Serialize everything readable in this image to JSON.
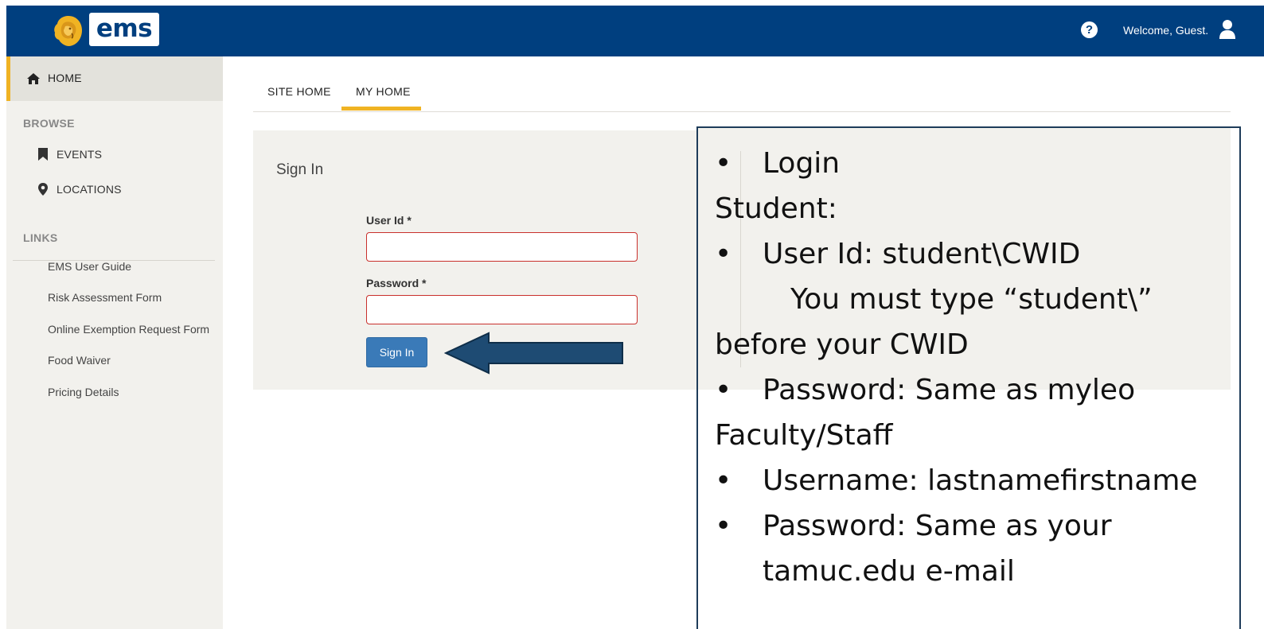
{
  "header": {
    "logo_text": "ems",
    "welcome_text": "Welcome, Guest.",
    "help_icon": "question-circle-icon",
    "user_icon": "user-icon",
    "bar_color": "#003f7f"
  },
  "sidebar": {
    "home_label": "HOME",
    "browse_heading": "BROWSE",
    "browse_items": [
      {
        "label": "EVENTS",
        "icon": "bookmark-icon"
      },
      {
        "label": "LOCATIONS",
        "icon": "map-marker-icon"
      }
    ],
    "links_heading": "LINKS",
    "links": [
      "EMS User Guide",
      "Risk Assessment Form",
      "Online Exemption Request Form",
      "Food Waiver",
      "Pricing Details"
    ],
    "active_accent": "#f0b323"
  },
  "tabs": [
    {
      "label": "SITE HOME",
      "active": false
    },
    {
      "label": "MY HOME",
      "active": true
    }
  ],
  "signin": {
    "title": "Sign In",
    "user_id_label": "User Id *",
    "user_id_value": "",
    "password_label": "Password *",
    "password_value": "",
    "button_label": "Sign In",
    "button_color": "#3a7ab8"
  },
  "instructions": {
    "lines": [
      {
        "bullet": true,
        "text": "Login"
      },
      {
        "bullet": false,
        "text": "Student:"
      },
      {
        "bullet": true,
        "text": "User Id: student\\CWID"
      },
      {
        "bullet": false,
        "text": "You must type “student\\”"
      },
      {
        "bullet": false,
        "text": "before your CWID"
      },
      {
        "bullet": true,
        "text": "Password: Same as myleo"
      },
      {
        "bullet": false,
        "text": "Faculty/Staff"
      },
      {
        "bullet": true,
        "text": "Username: lastnamefirstname"
      },
      {
        "bullet": true,
        "text": "Password: Same as your"
      },
      {
        "bullet": false,
        "text": "tamuc.edu e-mail"
      }
    ],
    "bullet_char": "•",
    "arrow_color": "#1e4b73"
  }
}
